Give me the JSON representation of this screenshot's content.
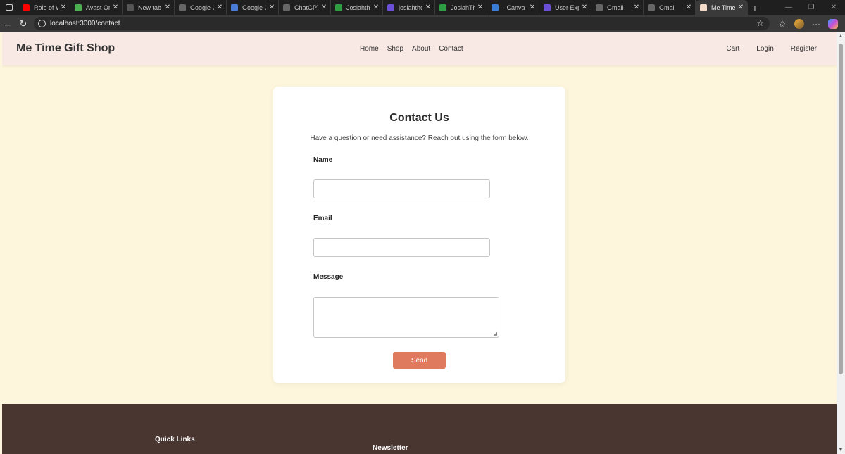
{
  "browser": {
    "tabs": [
      {
        "title": "Role of We",
        "favicon": "youtube-icon",
        "color": "#ff0000"
      },
      {
        "title": "Avast Onli",
        "favicon": "windows-icon",
        "color": "#4caf50"
      },
      {
        "title": "New tab",
        "favicon": "new-tab-icon",
        "color": "#555555"
      },
      {
        "title": "Google Ca",
        "favicon": "google-icon",
        "color": "#666666"
      },
      {
        "title": "Google Ge",
        "favicon": "gemini-icon",
        "color": "#4a7bd6"
      },
      {
        "title": "ChatGPT",
        "favicon": "chatgpt-icon",
        "color": "#666666"
      },
      {
        "title": "JosiahtheD",
        "favicon": "play-icon",
        "color": "#2e9e44"
      },
      {
        "title": "josiahthed",
        "favicon": "doc-icon",
        "color": "#6b4fd6"
      },
      {
        "title": "JosiahThe",
        "favicon": "k-icon",
        "color": "#2e9e44"
      },
      {
        "title": "- Canva",
        "favicon": "canva-icon",
        "color": "#3a7bd5"
      },
      {
        "title": "User Expe",
        "favicon": "list-icon",
        "color": "#6b4fd6"
      },
      {
        "title": "Gmail",
        "favicon": "gmail-icon",
        "color": "#666666"
      },
      {
        "title": "Gmail",
        "favicon": "gmail-icon",
        "color": "#666666"
      },
      {
        "title": "Me Time G",
        "favicon": "site-icon",
        "color": "#f3d9c7",
        "active": true
      }
    ],
    "url": "localhost:3000/contact"
  },
  "header": {
    "brand": "Me Time Gift Shop",
    "nav": [
      "Home",
      "Shop",
      "About",
      "Contact"
    ],
    "auth": [
      "Cart",
      "Login",
      "Register"
    ]
  },
  "contact": {
    "title": "Contact Us",
    "subtitle": "Have a question or need assistance? Reach out using the form below.",
    "name_label": "Name",
    "email_label": "Email",
    "message_label": "Message",
    "send_label": "Send"
  },
  "footer": {
    "quick_links": "Quick Links",
    "newsletter": "Newsletter"
  },
  "colors": {
    "page_bg": "#fdf6dc",
    "header_bg": "#f8e9e4",
    "accent": "#e07a5f",
    "footer_bg": "#4a3630"
  }
}
